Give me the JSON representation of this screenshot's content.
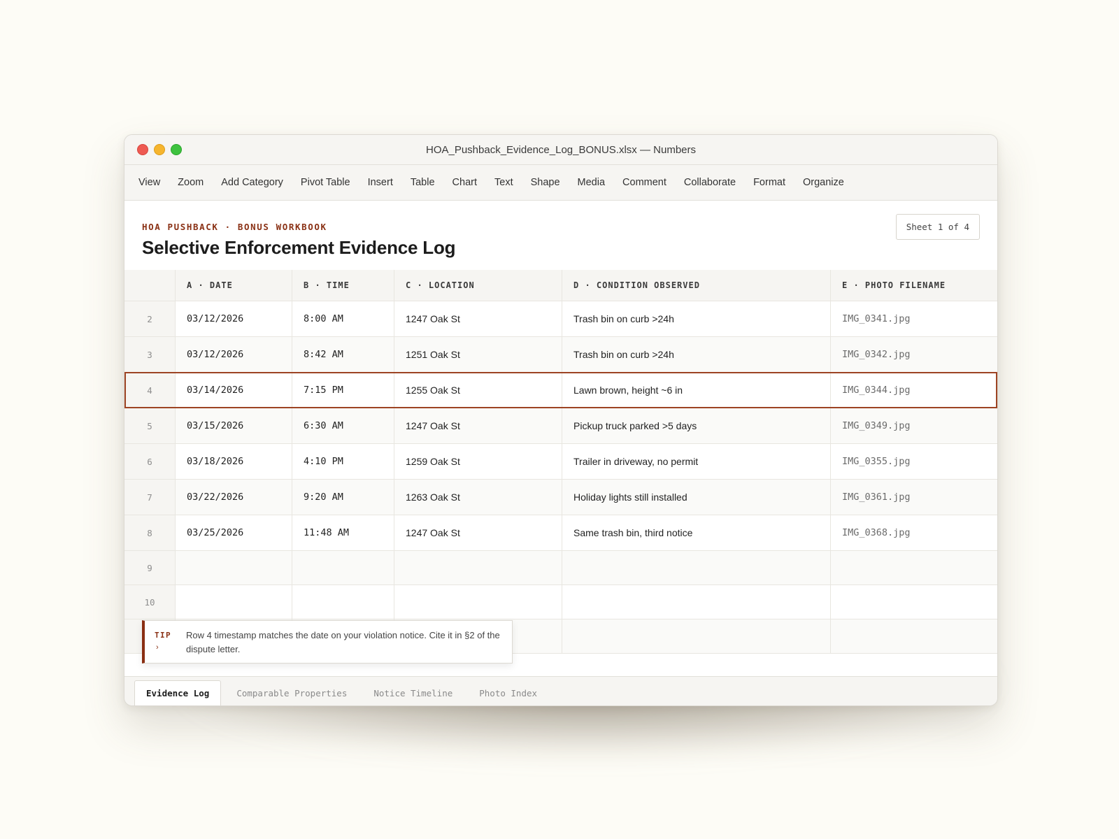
{
  "window": {
    "title": "HOA_Pushback_Evidence_Log_BONUS.xlsx — Numbers"
  },
  "menu": [
    "View",
    "Zoom",
    "Add Category",
    "Pivot Table",
    "Insert",
    "Table",
    "Chart",
    "Text",
    "Shape",
    "Media",
    "Comment",
    "Collaborate",
    "Format",
    "Organize"
  ],
  "header": {
    "eyebrow": "HOA PUSHBACK · BONUS WORKBOOK",
    "title": "Selective Enforcement Evidence Log",
    "sheet_badge": "Sheet 1 of 4"
  },
  "columns": [
    "A · DATE",
    "B · TIME",
    "C · LOCATION",
    "D · CONDITION OBSERVED",
    "E · PHOTO FILENAME"
  ],
  "rows": [
    {
      "num": "2",
      "date": "03/12/2026",
      "time": "8:00 AM",
      "location": "1247 Oak St",
      "condition": "Trash bin on curb >24h",
      "photo": "IMG_0341.jpg"
    },
    {
      "num": "3",
      "date": "03/12/2026",
      "time": "8:42 AM",
      "location": "1251 Oak St",
      "condition": "Trash bin on curb >24h",
      "photo": "IMG_0342.jpg"
    },
    {
      "num": "4",
      "date": "03/14/2026",
      "time": "7:15 PM",
      "location": "1255 Oak St",
      "condition": "Lawn brown, height ~6 in",
      "photo": "IMG_0344.jpg"
    },
    {
      "num": "5",
      "date": "03/15/2026",
      "time": "6:30 AM",
      "location": "1247 Oak St",
      "condition": "Pickup truck parked >5 days",
      "photo": "IMG_0349.jpg"
    },
    {
      "num": "6",
      "date": "03/18/2026",
      "time": "4:10 PM",
      "location": "1259 Oak St",
      "condition": "Trailer in driveway, no permit",
      "photo": "IMG_0355.jpg"
    },
    {
      "num": "7",
      "date": "03/22/2026",
      "time": "9:20 AM",
      "location": "1263 Oak St",
      "condition": "Holiday lights still installed",
      "photo": "IMG_0361.jpg"
    },
    {
      "num": "8",
      "date": "03/25/2026",
      "time": "11:48 AM",
      "location": "1247 Oak St",
      "condition": "Same trash bin, third notice",
      "photo": "IMG_0368.jpg"
    }
  ],
  "empty_rows": [
    "9",
    "10",
    ""
  ],
  "tip": {
    "label": "TIP",
    "arrow": "›",
    "text": "Row 4 timestamp matches the date on your violation notice. Cite it in §2 of the dispute letter."
  },
  "tabs": [
    "Evidence Log",
    "Comparable Properties",
    "Notice Timeline",
    "Photo Index"
  ],
  "colors": {
    "accent": "#8a3115",
    "selection": "#9d4424"
  }
}
